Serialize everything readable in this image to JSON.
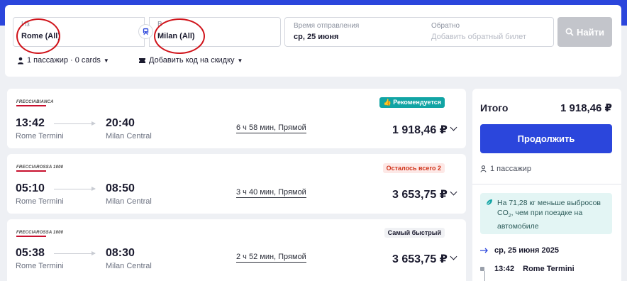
{
  "search": {
    "from_label": "Из",
    "from_value": "Rome (All)",
    "to_label": "В",
    "to_value": "Milan (All)",
    "depart_label": "Время отправления",
    "depart_value": "ср, 25 июня",
    "return_label": "Обратно",
    "return_placeholder": "Добавить обратный билет",
    "search_button": "Найти",
    "passengers": "1 пассажир · 0 cards",
    "discount": "Добавить код на скидку"
  },
  "results": [
    {
      "operator": "FRECCIABIANCA",
      "badge": "Рекомендуется",
      "badge_type": "recommended",
      "dep_time": "13:42",
      "dep_station": "Rome Termini",
      "arr_time": "20:40",
      "arr_station": "Milan Central",
      "duration": "6 ч 58 мин, Прямой",
      "price": "1 918,46 ₽"
    },
    {
      "operator": "FRECCIAROSSA 1000",
      "badge": "Осталось всего 2",
      "badge_type": "limited",
      "dep_time": "05:10",
      "dep_station": "Rome Termini",
      "arr_time": "08:50",
      "arr_station": "Milan Central",
      "duration": "3 ч 40 мин, Прямой",
      "price": "3 653,75 ₽"
    },
    {
      "operator": "FRECCIAROSSA 1000",
      "badge": "Самый быстрый",
      "badge_type": "fastest",
      "dep_time": "05:38",
      "dep_station": "Rome Termini",
      "arr_time": "08:30",
      "arr_station": "Milan Central",
      "duration": "2 ч 52 мин, Прямой",
      "price": "3 653,75 ₽"
    }
  ],
  "summary": {
    "title": "Итого",
    "total": "1 918,46 ₽",
    "continue_button": "Продолжить",
    "passengers": "1 пассажир",
    "eco_note_1": "На 71,28 кг меньше выбросов",
    "eco_note_2": "CO",
    "eco_note_sub": "2",
    "eco_note_3": ", чем при поездке на автомобиле",
    "trip_date": "ср, 25 июня 2025",
    "first_stop_time": "13:42",
    "first_stop_station": "Rome Termini"
  },
  "colors": {
    "brand": "#2b46dc",
    "recommended": "#11a4a4",
    "limited": "#d0341b",
    "annotation_circle": "#d0141b"
  }
}
